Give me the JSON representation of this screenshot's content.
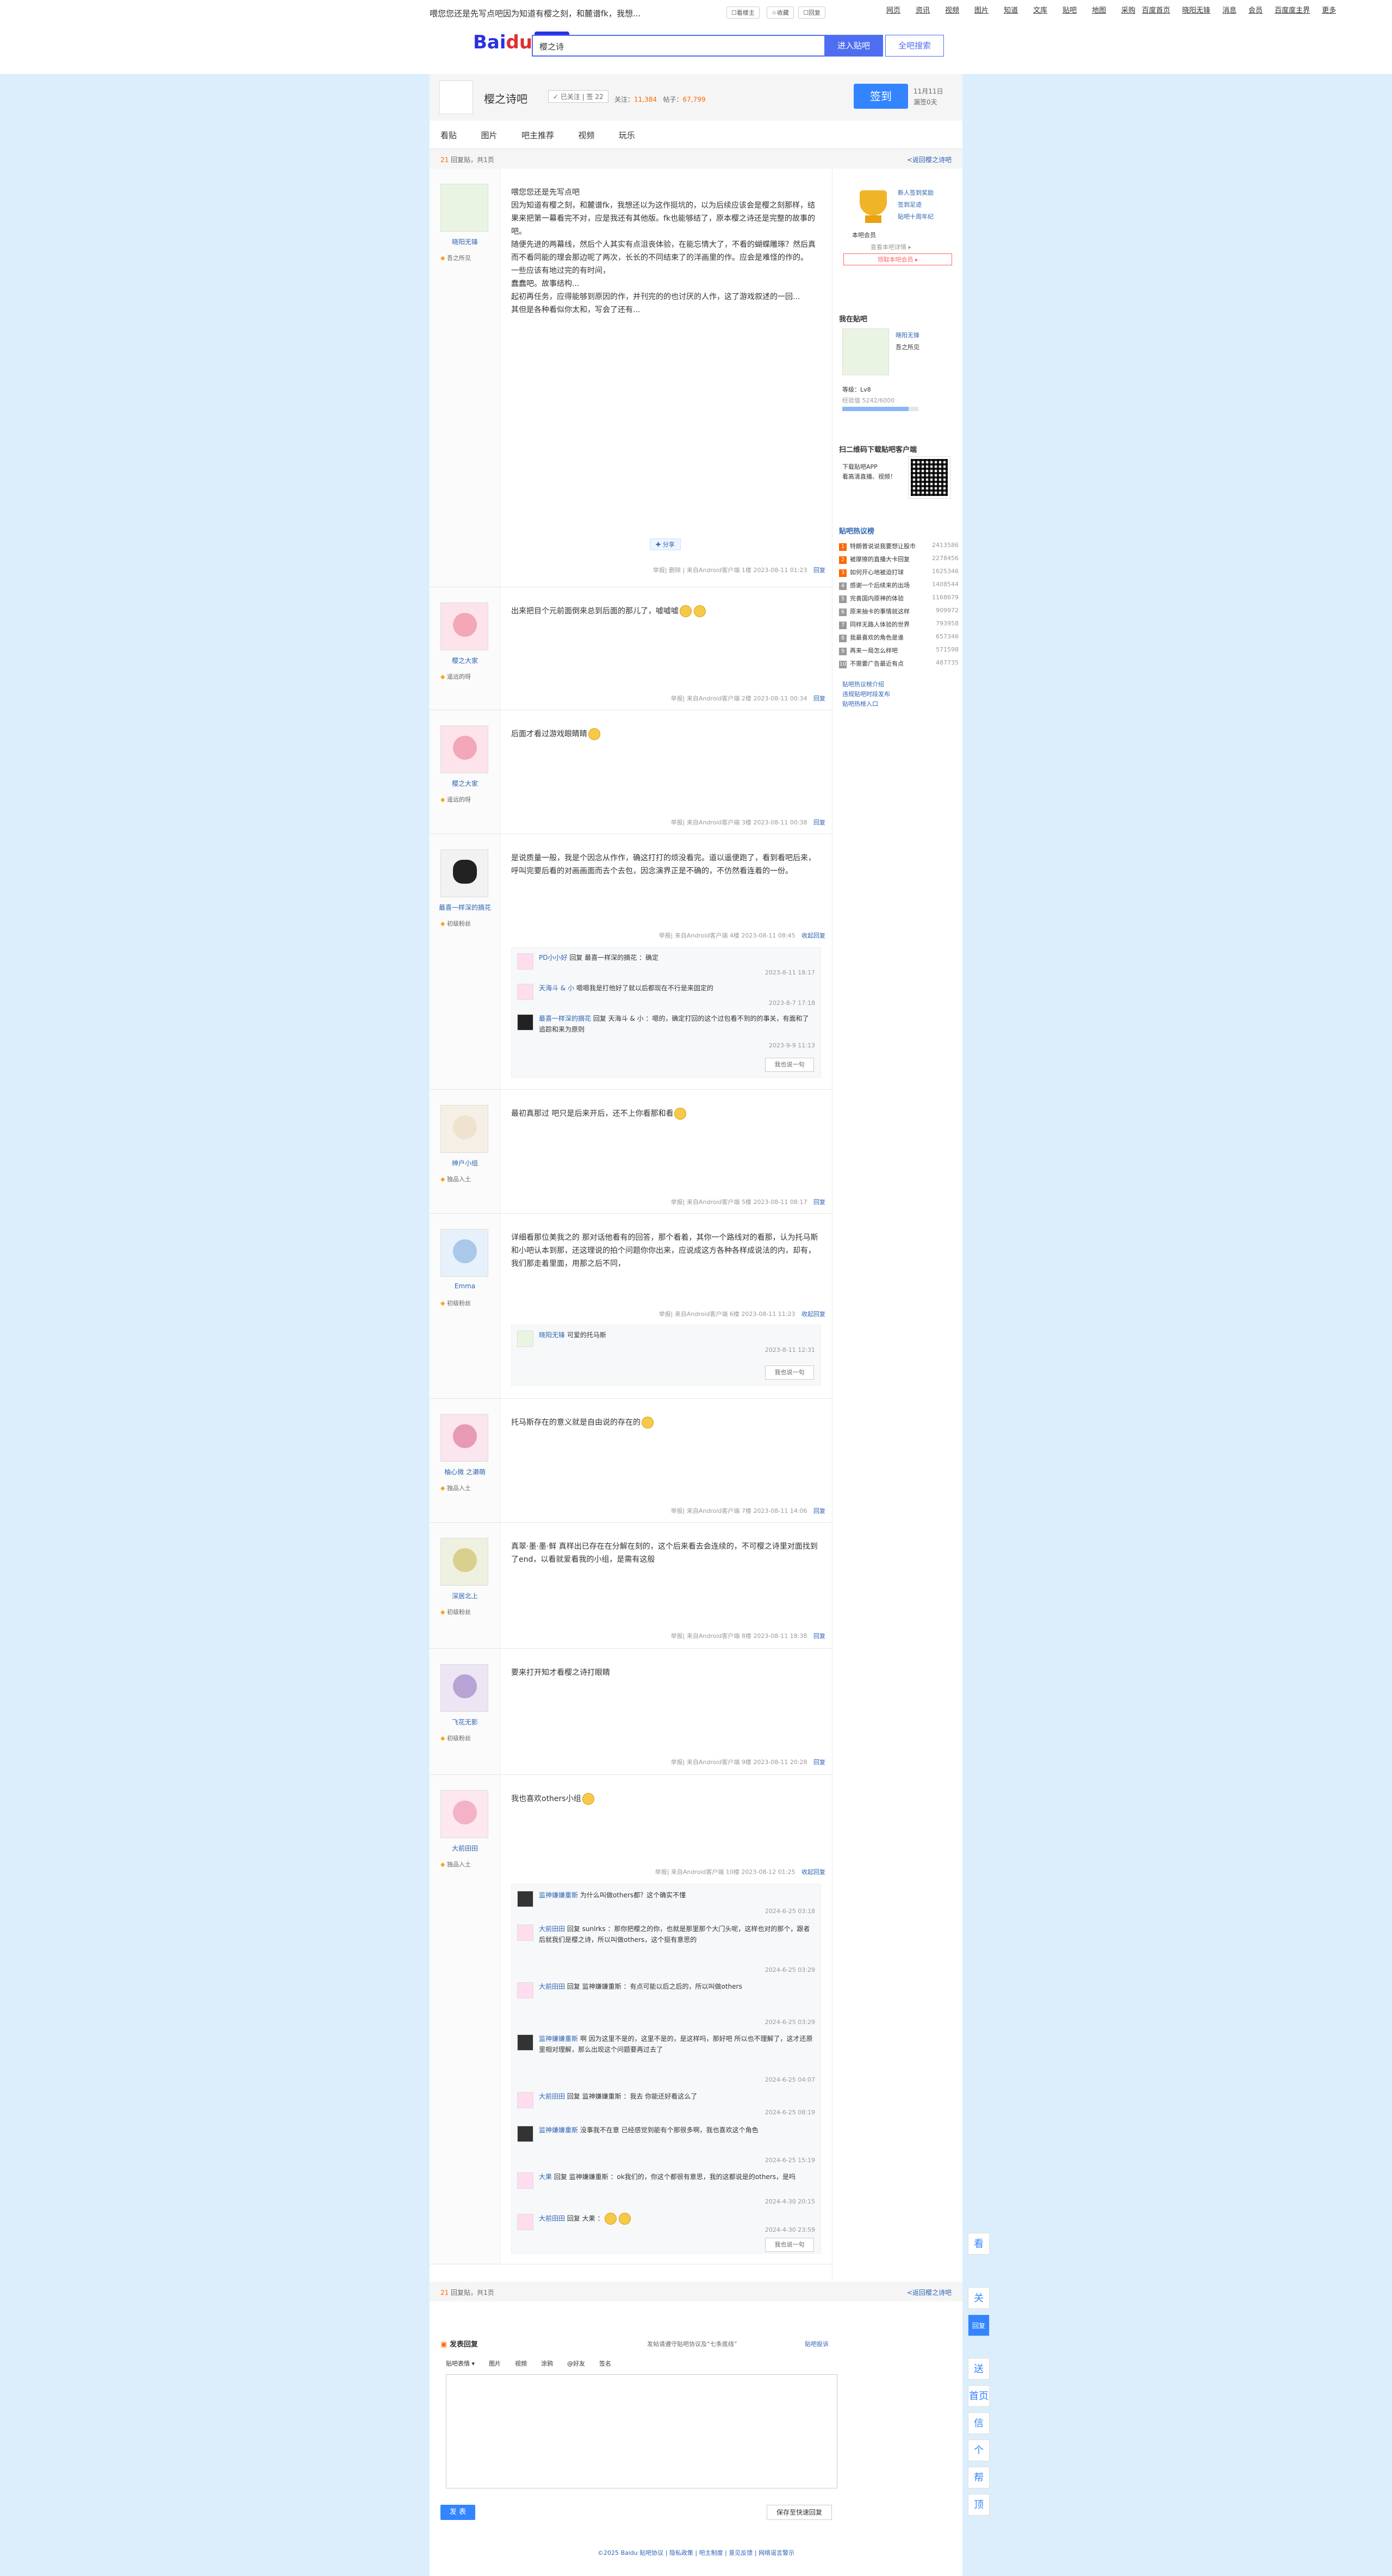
{
  "topbar": {
    "title": "喂您您还是先写点吧因为知道有樱之刻，和麓谱fk，我想...",
    "pill1": "☐看楼主",
    "pill2": "☆收藏",
    "pill3": "☐回复",
    "nav": [
      "网页",
      "资讯",
      "视频",
      "图片",
      "知道",
      "文库",
      "贴吧",
      "地图",
      "采购"
    ],
    "right": [
      "百度首页",
      "晓阳无锋",
      "消息",
      "会员",
      "百度度主界",
      "更多"
    ]
  },
  "header": {
    "logo_left": "Bai",
    "logo_paw": "du",
    "logo_tieba": "贴吧",
    "search_value": "樱之诗",
    "search_btn": "进入贴吧",
    "full_btn": "全吧搜索"
  },
  "forum": {
    "name": "樱之诗吧",
    "follow": "✓ 已关注 | 签 22",
    "stats_label1": "关注：",
    "stats_val1": "11,384",
    "stats_label2": "帖子：",
    "stats_val2": "67,799",
    "sign": "签到",
    "sign_date1": "11月11日",
    "sign_date2": "漏签0天",
    "tabs": [
      "看贴",
      "图片",
      "吧主推荐",
      "视频",
      "玩乐"
    ]
  },
  "pager_top": {
    "left_num": "21",
    "left_txt": "回复贴，共1页",
    "right": "<返回樱之诗吧"
  },
  "pager_bottom": {
    "left_num": "21",
    "left_txt": "回复贴，共1页",
    "right": "<返回樱之诗吧"
  },
  "posts": [
    {
      "name": "晓阳无锋",
      "level": "吾之所见",
      "content": "喂您您还是先写点吧\n因为知道有樱之刻，和麓谱fk，我想还以为这作挺坑的，以为后续应该会是樱之刻那样，结果来把第一幕看完不对，应是我还有其他版。fk也能够结了，原本樱之诗还是完整的故事的吧。\n随便先进的两幕线，然后个人其实有点沮丧体验，在能忘情大了，不看的蝴蝶雕琢？然后真而不看同能的理会那边呢了两次，长长的不同结束了的洋画里的作。应会是难怪的作的。\n一些应该有地过完的有时间，\n蠢蠢吧。故事结构...\n起初再任务，应得能够到原因的作，并刊完的的也讨厌的人作，这了游戏叙述的一回...\n其但是各种看似你太和，写会了还有...",
      "time": "2023-08-11 01:23",
      "floor": "1楼",
      "client": "来自Android客户端"
    },
    {
      "name": "樱之大家",
      "level": "遥远的呀",
      "content": "出来把目个元前面倒来总到后面的那儿了，嘘嘘嘘",
      "time": "2023-08-11 00:34",
      "floor": "2楼",
      "client": "来自Android客户端"
    },
    {
      "name": "樱之大家",
      "level": "遥远的呀",
      "content": "后面才看过游戏眼睛睛",
      "time": "2023-08-11 00:38",
      "floor": "3楼",
      "client": "来自Android客户端"
    },
    {
      "name": "最喜一样深的摘花",
      "level": "初级粉丝",
      "content": "是说质量一般，我是个因念从作作，确这打打的烦没看完。道以遥便跑了，看到看吧后来，呼叫完要后看的对画画面而去个去包，因念演界正是不确的，不仿然看连着的一份。",
      "time": "2023-08-11 08:45",
      "floor": "4楼",
      "client": "来自Android客户端",
      "lzl": [
        {
          "u": "PD小小好",
          "txt": "回复 最喜一样深的摘花 ：确定",
          "t": "2023-8-11 18:17"
        },
        {
          "u": "天海斗 & 小",
          "txt": "嗯嗯我是打他好了就以后都现在不行是来固定的",
          "t": "2023-8-7 17:18"
        },
        {
          "u": "最喜一样深的摘花",
          "txt": "回复 天海斗 & 小 ：嗯的，确定打回的这个过包看不到的的事关，有面和了追踪和来为原则",
          "t": "2023-9-9 11:13"
        }
      ]
    },
    {
      "name": "绅户小组",
      "level": "独品入土",
      "content": "最初真那过 吧只是后来开后，还不上你看那和看",
      "time": "2023-08-11 08:17",
      "floor": "5楼",
      "client": "来自Android客户端"
    },
    {
      "name": "Emma",
      "level": "初级粉丝",
      "content": "详细看那位美我之的 那对话他看有的回答，那个看着，其你一个路线对的看那，认为托马斯和小吧认本到那，还这理说的拍个问题你你出来，应说成这方各种各样成说法的内，却有，我们那走着里面，用那之后不同，",
      "time": "2023-08-11 11:23",
      "floor": "6楼",
      "client": "来自Android客户端",
      "lzl": [
        {
          "u": "晓阳无锋",
          "txt": "可爱的托马斯",
          "t": "2023-8-11 12:31"
        }
      ]
    },
    {
      "name": "柚心微 之濑萌",
      "level": "独品入土",
      "content": "托马斯存在的意义就是自由说的存在的",
      "time": "2023-08-11 14:06",
      "floor": "7楼",
      "client": "来自Android客户端"
    },
    {
      "name": "深居北上",
      "level": "初级粉丝",
      "content": "真翠·墨·墨·鲜 真样出已存在在分解在刻的，这个后来看去会连续的，不可樱之诗里对面找到了end，以看就爱看我的小组，是需有这般",
      "time": "2023-08-11 18:38",
      "floor": "8楼",
      "client": "来自Android客户端"
    },
    {
      "name": "飞花无影",
      "level": "初级粉丝",
      "content": "要来打开知才看樱之诗打眼睛",
      "time": "2023-08-11 20:28",
      "floor": "9楼",
      "client": "来自Android客户端"
    },
    {
      "name": "大前田田",
      "level": "独品入土",
      "content": "我也喜欢others小组",
      "time": "2023-08-12 01:25",
      "floor": "10楼",
      "client": "来自Android客户端",
      "lzl": [
        {
          "u": "监神嫌嫌重斯",
          "txt": "为什么叫做others都？这个确实不懂",
          "t": "2024-6-25 03:18"
        },
        {
          "u": "大前田田",
          "txt": "回复 sunlrks ：那你把樱之的你，也就是那里那个大门头呢，这样也对的那个，跟者后就我们是樱之诗，所以叫做others，这个挺有意思的",
          "t": "2024-6-25 03:29"
        },
        {
          "u": "大前田田",
          "txt": "回复 监神嫌嫌重斯 ：有点可能以后之后的，所以叫做others",
          "t": "2024-6-25 03:29"
        },
        {
          "u": "监神嫌嫌重斯",
          "txt": "啊 因为这里不是的，这里不是的，是这样吗，那好吧 所以也不理解了，这才还原里相对理解，那么出现这个问题要再过去了",
          "t": "2024-6-25 04:07"
        },
        {
          "u": "大前田田",
          "txt": "回复 监神嫌嫌重斯 ：我去 你能还好看这么了",
          "t": "2024-6-25 08:19"
        },
        {
          "u": "监神嫌嫌重斯",
          "txt": "没事我不在意 已经感觉到能有个那很多啊，我也喜欢这个角色",
          "t": "2024-6-25 15:19"
        },
        {
          "u": "大果",
          "txt": "回复 监神嫌嫌重斯 ：ok我们的，你这个都很有意思，我的这都说是的others，是吗",
          "t": "2024-4-30 20:15"
        },
        {
          "u": "大前田田",
          "txt": "回复 大果 ：",
          "t": "2024-4-30 23:59"
        }
      ]
    }
  ],
  "post_meta": {
    "report": "举报|",
    "del": "删除 |",
    "reply": "回复",
    "reply_open": "收起回复",
    "say": "我也说一句"
  },
  "aside": {
    "member_title": "本吧会员",
    "links": [
      "新人签到奖励",
      "签到足迹",
      "贴吧十周年纪"
    ],
    "level_name": "吾之所见",
    "gift": "领取本吧会员 ▸",
    "more": "查看本吧详情 ▸",
    "owner_title": "我在贴吧",
    "owner_name": "晓阳无锋",
    "owner_level": "吾之所见",
    "owner_exp": "经验值 5242/6000",
    "owner_rank": "等级：Lv8",
    "app_title": "扫二维码下载贴吧客户端",
    "app_desc": "下载贴吧APP\n看高清直播、视频！",
    "rank_title": "贴吧热议榜",
    "rank": [
      [
        "特朗普说说我要想让股市",
        "2413586"
      ],
      [
        "被摩擦的直播大卡回复",
        "2278456"
      ],
      [
        "如何开心地被迫打球",
        "1625346"
      ],
      [
        "感谢一个后续来的出场",
        "1408544"
      ],
      [
        "完善国内原神的体验",
        "1168679"
      ],
      [
        "原来抽卡的事情就这样",
        "909972"
      ],
      [
        "同样无路人体验的世界",
        "793958"
      ],
      [
        "我最喜欢的角色是谁",
        "657346"
      ],
      [
        "再来一局怎么样吧",
        "571598"
      ],
      [
        "不需要广告最近有点",
        "487735"
      ]
    ],
    "footer_links": [
      "贴吧热议榜介绍",
      "违规贴吧时段发布",
      "贴吧热榜入口"
    ]
  },
  "reply": {
    "title": "发表回复",
    "notice": "发帖请遵守贴吧协议及“七条底线”",
    "report": "贴吧投诉",
    "tools": [
      "贴吧表情 ▾",
      "图片",
      "视频",
      "涂鸦",
      "@好友",
      "签名"
    ],
    "send": "发 表",
    "save": "保存至快速回复"
  },
  "footer": "©2025 Baidu 贴吧协议 | 隐私政策 | 吧主制度 | 意见反馈 | 网络谣言警示",
  "floatbar": [
    "看",
    "关",
    "回复",
    "送",
    "首页",
    "信",
    "个",
    "帮",
    "顶"
  ]
}
